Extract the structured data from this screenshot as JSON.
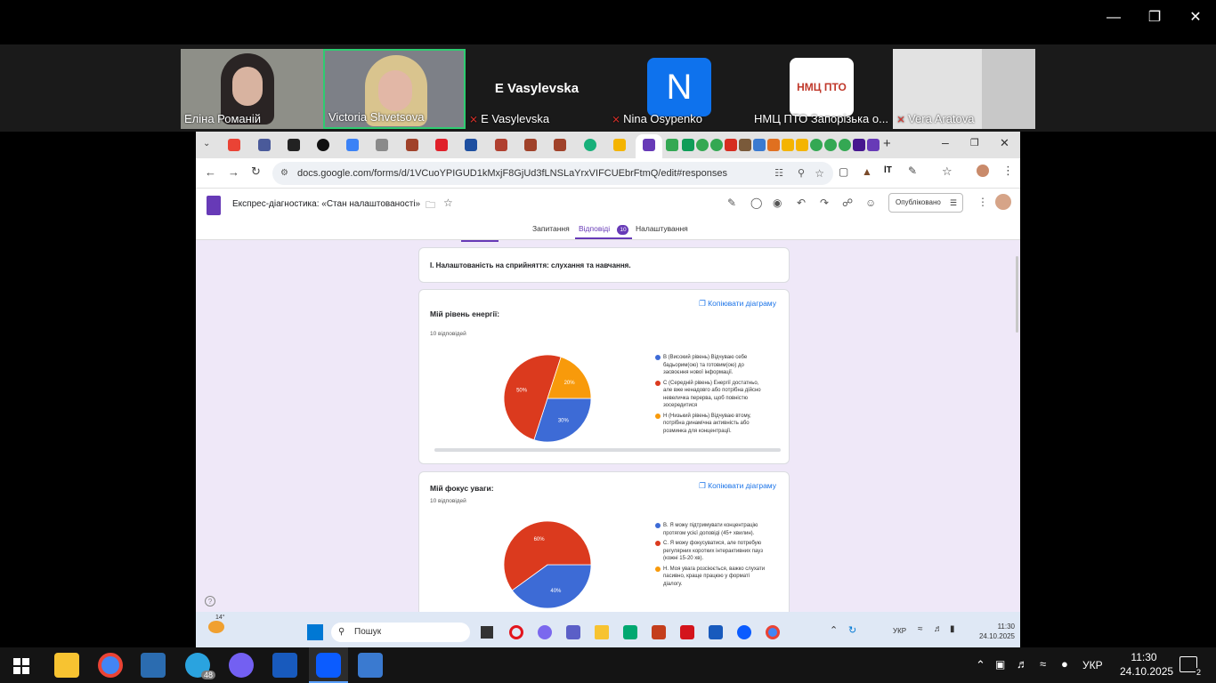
{
  "participants": [
    {
      "name": "Еліна Романій",
      "muted": false
    },
    {
      "name": "Victoria Shvetsova",
      "muted": false
    },
    {
      "name": "E Vasylevska",
      "muted": true,
      "big_name": "E Vasylevska"
    },
    {
      "name": "Nina Osypenko",
      "muted": true,
      "initial": "N"
    },
    {
      "name": "НМЦ ПТО Запорізька о...",
      "muted": false,
      "logo_text": "НМЦ ПТО"
    },
    {
      "name": "Vera Aratova",
      "muted": true
    }
  ],
  "browser": {
    "url": "docs.google.com/forms/d/1VCuoYPIGUD1kMxjF8GjUd3fLNSLaYrxVIFCUEbrFtmQ/edit#responses"
  },
  "form": {
    "title": "Експрес-діагностика: «Стан налаштованості»",
    "publish_label": "Опубліковано",
    "tabs": [
      {
        "label": "Запитання",
        "active": false
      },
      {
        "label": "Відповіді",
        "active": true,
        "badge": "10"
      },
      {
        "label": "Налаштування",
        "active": false
      }
    ],
    "section_title": "I. Налаштованість на сприйняття: слухання та навчання.",
    "copy_label": "Копіювати діаграму"
  },
  "chart_data": [
    {
      "type": "pie",
      "title": "Мій рівень енергії:",
      "subtitle": "10 відповідей",
      "slices": [
        {
          "label": "В (Високий рівень) Відчуваю себе бадьорим(ою) та готовим(ою) до засвоєння нової інформації.",
          "value": 30,
          "pct_label": "30%",
          "color": "#3d6bd6"
        },
        {
          "label": "С (Середній рівень) Енергії достатньо, але вже ненадовго або потрібна дійсно невеличка перерва, щоб повністю зосередитися",
          "value": 50,
          "pct_label": "50%",
          "color": "#db3a1e"
        },
        {
          "label": "Н (Низький рівень) Відчуваю втому, потрібна динамічна активність або розминка для концентрації.",
          "value": 20,
          "pct_label": "20%",
          "color": "#f89a0b"
        }
      ]
    },
    {
      "type": "pie",
      "title": "Мій фокус уваги:",
      "subtitle": "10 відповідей",
      "slices": [
        {
          "label": "В. Я можу підтримувати концентрацію протягом усієї доповіді (45+ хвилин).",
          "value": 40,
          "pct_label": "40%",
          "color": "#3d6bd6"
        },
        {
          "label": "С. Я можу фокусуватися, але потребую регулярних коротких інтерактивних пауз (кожні 15-20 хв).",
          "value": 60,
          "pct_label": "60%",
          "color": "#db3a1e"
        },
        {
          "label": "Н. Моя увага розсіюється, важко слухати пасивно, краще працюю у форматі діалогу.",
          "value": 0,
          "pct_label": "",
          "color": "#f89a0b"
        }
      ]
    }
  ],
  "inner_taskbar": {
    "weather": "14°",
    "search_label": "Пошук",
    "lang": "УКР",
    "time": "11:30",
    "date": "24.10.2025"
  },
  "taskbar": {
    "telegram_badge": "48",
    "lang": "УКР",
    "time": "11:30",
    "date": "24.10.2025",
    "notif_count": "2"
  }
}
